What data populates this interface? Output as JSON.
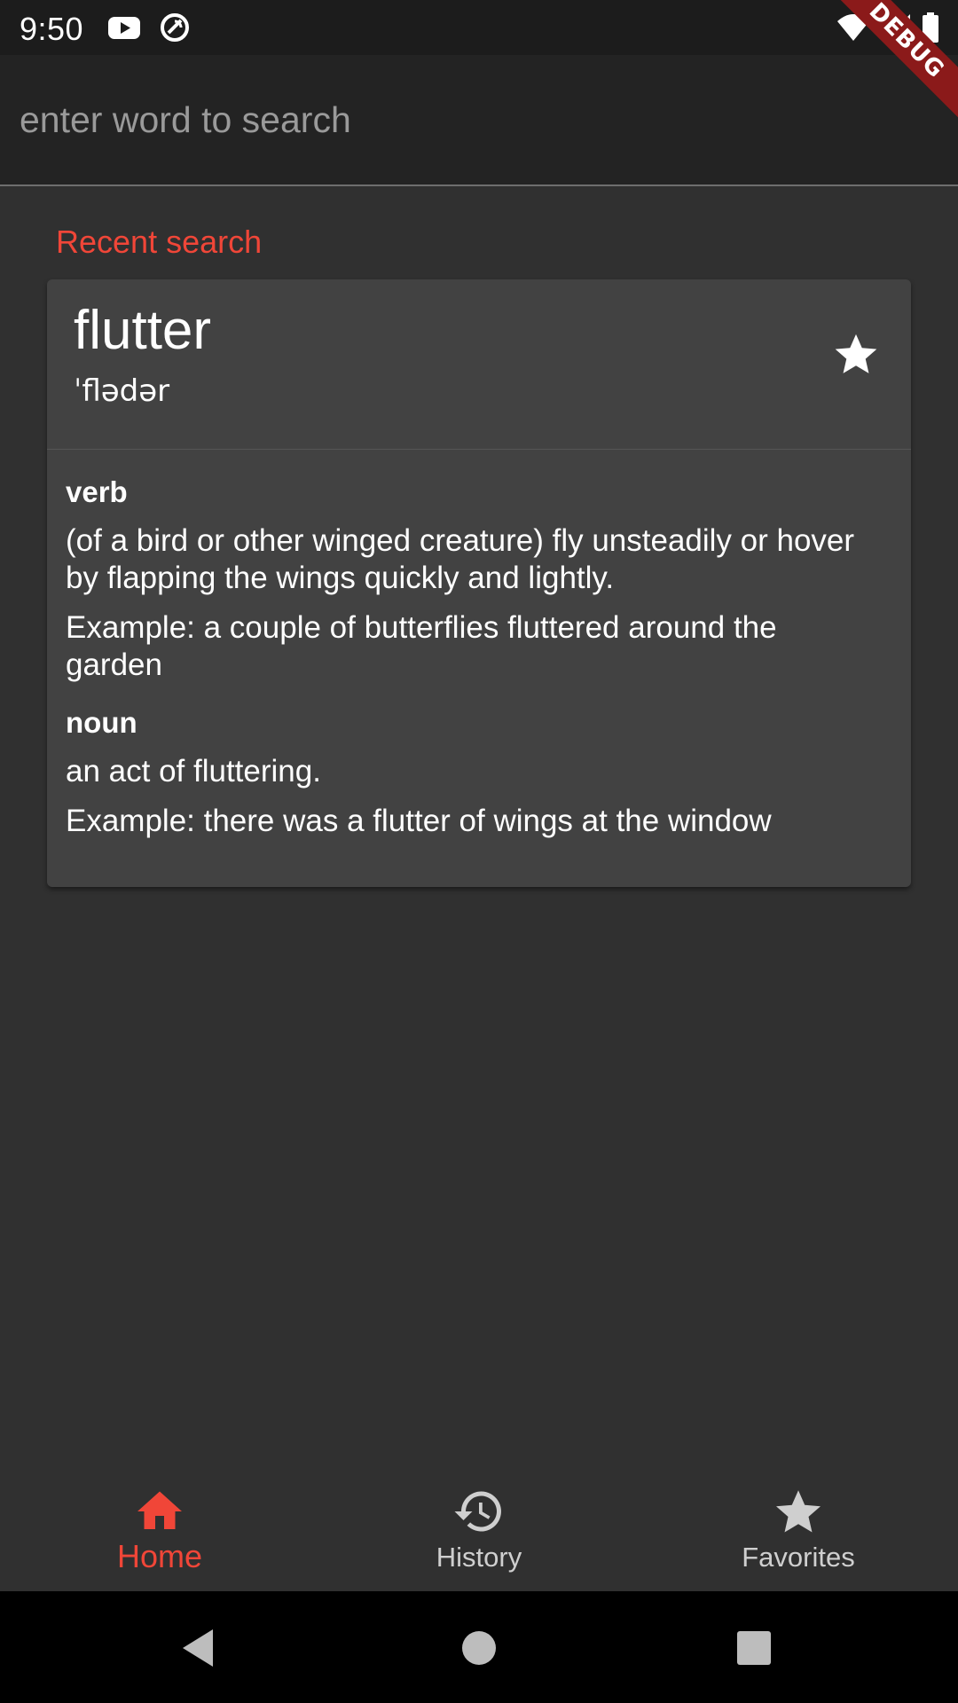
{
  "status_bar": {
    "time": "9:50",
    "icons": [
      "youtube-icon",
      "sync-icon",
      "wifi-icon",
      "signal-icon",
      "battery-icon"
    ]
  },
  "debug_banner": {
    "label": "DEBUG",
    "color": "#8b1a1a"
  },
  "search": {
    "placeholder": "enter word to search",
    "value": ""
  },
  "recent": {
    "label": "Recent search",
    "accent_color": "#f04638"
  },
  "word_card": {
    "word": "flutter",
    "phonetic": "ˈflədər",
    "favorite_icon": "star-icon",
    "meanings": [
      {
        "part_of_speech": "verb",
        "definition": "(of a bird or other winged creature) fly unsteadily or hover by flapping the wings quickly and lightly.",
        "example": "Example: a couple of butterflies fluttered around the garden"
      },
      {
        "part_of_speech": "noun",
        "definition": "an act of fluttering.",
        "example": "Example: there was a flutter of wings at the window"
      }
    ]
  },
  "bottom_nav": {
    "items": [
      {
        "label": "Home",
        "icon": "home-icon",
        "active": true
      },
      {
        "label": "History",
        "icon": "history-icon",
        "active": false
      },
      {
        "label": "Favorites",
        "icon": "star-icon",
        "active": false
      }
    ]
  },
  "system_nav": {
    "buttons": [
      "back-icon",
      "home-circle-icon",
      "recents-icon"
    ]
  }
}
